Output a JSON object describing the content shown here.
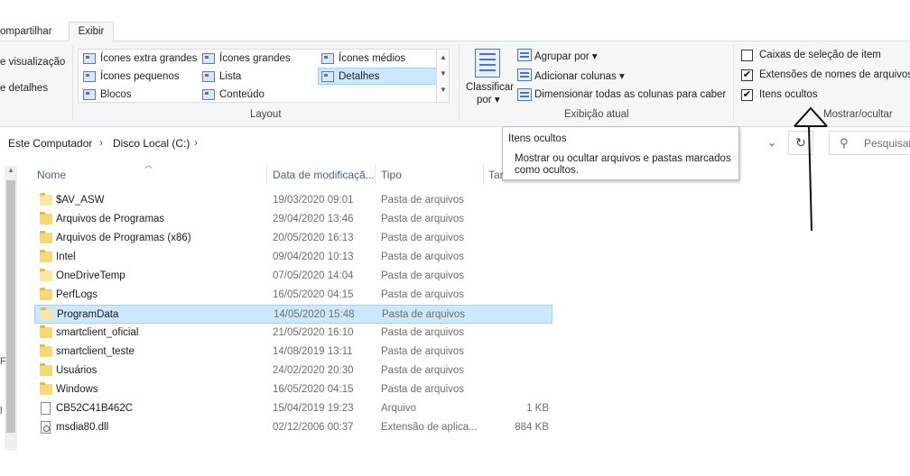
{
  "ribbon_tabs": {
    "share": "ompartilhar",
    "view": "Exibir"
  },
  "panes_group": {
    "preview": "e visualização",
    "details": "e detalhes"
  },
  "layout": {
    "items": [
      "Ícones extra grandes",
      "Ícones grandes",
      "Ícones médios",
      "Ícones pequenos",
      "Lista",
      "Detalhes",
      "Blocos",
      "Conteúdo"
    ],
    "selected": "Detalhes",
    "group_label": "Layout"
  },
  "current_view": {
    "sort_label": "Classificar",
    "sort_sub": "por ▾",
    "group_by": "Agrupar por ▾",
    "add_columns": "Adicionar colunas ▾",
    "size_columns": "Dimensionar todas as colunas para caber",
    "group_label": "Exibição atual"
  },
  "show_hide": {
    "item_checkboxes": {
      "label": "Caixas de seleção de item",
      "checked": false
    },
    "file_extensions": {
      "label": "Extensões de nomes de arquivos",
      "checked": true
    },
    "hidden_items": {
      "label": "Itens ocultos",
      "checked": true
    },
    "group_label": "Mostrar/ocultar"
  },
  "address": {
    "crumbs": [
      "Este Computador",
      "Disco Local (C:)"
    ],
    "separator": "›",
    "dropdown": "⌄",
    "refresh": "↻",
    "search_placeholder": "Pesquisar"
  },
  "tooltip": {
    "title": "Itens ocultos",
    "body": "Mostrar ou ocultar arquivos e pastas marcados como ocultos."
  },
  "columns": {
    "name": "Nome",
    "date": "Data de modificaçã...",
    "type": "Tipo",
    "size": "Tar"
  },
  "files": [
    {
      "name": "$AV_ASW",
      "date": "19/03/2020 09:01",
      "type": "Pasta de arquivos",
      "size": "",
      "kind": "folder-light"
    },
    {
      "name": "Arquivos de Programas",
      "date": "29/04/2020 13:46",
      "type": "Pasta de arquivos",
      "size": "",
      "kind": "folder"
    },
    {
      "name": "Arquivos de Programas (x86)",
      "date": "20/05/2020 16:13",
      "type": "Pasta de arquivos",
      "size": "",
      "kind": "folder"
    },
    {
      "name": "Intel",
      "date": "09/04/2020 10:13",
      "type": "Pasta de arquivos",
      "size": "",
      "kind": "folder"
    },
    {
      "name": "OneDriveTemp",
      "date": "07/05/2020 14:04",
      "type": "Pasta de arquivos",
      "size": "",
      "kind": "folder-light"
    },
    {
      "name": "PerfLogs",
      "date": "16/05/2020 04:15",
      "type": "Pasta de arquivos",
      "size": "",
      "kind": "folder"
    },
    {
      "name": "ProgramData",
      "date": "14/05/2020 15:48",
      "type": "Pasta de arquivos",
      "size": "",
      "kind": "folder-light",
      "selected": true
    },
    {
      "name": "smartclient_oficial",
      "date": "21/05/2020 16:10",
      "type": "Pasta de arquivos",
      "size": "",
      "kind": "folder"
    },
    {
      "name": "smartclient_teste",
      "date": "14/08/2019 13:11",
      "type": "Pasta de arquivos",
      "size": "",
      "kind": "folder"
    },
    {
      "name": "Usuários",
      "date": "24/02/2020 20:30",
      "type": "Pasta de arquivos",
      "size": "",
      "kind": "folder"
    },
    {
      "name": "Windows",
      "date": "16/05/2020 04:15",
      "type": "Pasta de arquivos",
      "size": "",
      "kind": "folder"
    },
    {
      "name": "CB52C41B462C",
      "date": "15/04/2019 19:23",
      "type": "Arquivo",
      "size": "1 KB",
      "kind": "file"
    },
    {
      "name": "msdia80.dll",
      "date": "02/12/2006 00:37",
      "type": "Extensão de aplica...",
      "size": "884 KB",
      "kind": "dll"
    }
  ],
  "nav_stubs": [
    "F",
    "l"
  ]
}
